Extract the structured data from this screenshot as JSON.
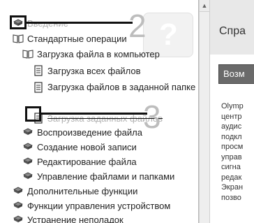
{
  "nav": {
    "items": [
      {
        "label": "Введение",
        "icon": "closed-book-icon"
      },
      {
        "label": "Стандартные операции",
        "icon": "open-book-icon"
      },
      {
        "label": "Загрузка файла в компьютер",
        "icon": "open-book-icon"
      },
      {
        "label": "Загрузка всех файлов",
        "icon": "page-icon"
      },
      {
        "label": "Загрузка файлов в заданной папке",
        "icon": "page-icon"
      },
      {
        "label": "Загрузка заданных файлов",
        "icon": "page-icon"
      },
      {
        "label": "Воспроизведение файла",
        "icon": "closed-book-icon"
      },
      {
        "label": "Создание новой записи",
        "icon": "closed-book-icon"
      },
      {
        "label": "Редактирование файла",
        "icon": "closed-book-icon"
      },
      {
        "label": "Управление файлами и папками",
        "icon": "closed-book-icon"
      },
      {
        "label": "Дополнительные функции",
        "icon": "closed-book-icon"
      },
      {
        "label": "Функции управления устройством",
        "icon": "closed-book-icon"
      },
      {
        "label": "Устранение неполадок",
        "icon": "closed-book-icon"
      }
    ]
  },
  "annotations": {
    "callout_1": "2",
    "callout_2": "3"
  },
  "content": {
    "title": "Спра",
    "section_header": "Возм",
    "paragraph_lines": [
      "Olymp",
      "центр",
      "аудис",
      "подкл",
      "просм",
      "управ",
      "сигна",
      "редак",
      "Экран",
      "позво"
    ]
  },
  "colors": {
    "section_bg": "#6a6a6a",
    "annotation": "#111111",
    "callout_digit": "#bdbdbd"
  }
}
